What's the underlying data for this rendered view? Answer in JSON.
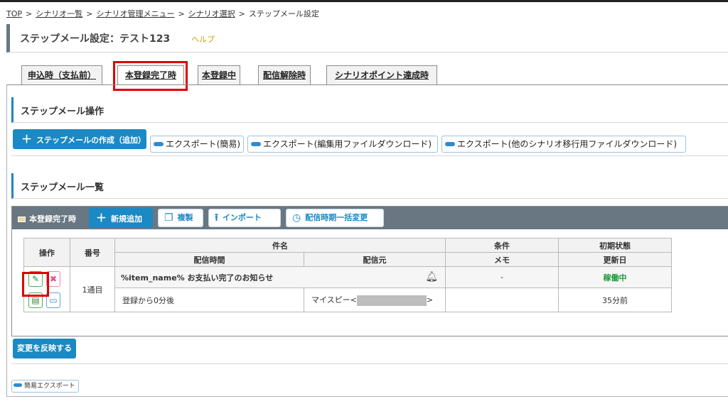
{
  "breadcrumb": {
    "items": [
      "TOP",
      "シナリオ一覧",
      "シナリオ管理メニュー",
      "シナリオ選択"
    ],
    "current": "ステップメール設定"
  },
  "page": {
    "title": "ステップメール設定：テスト123",
    "help": "ヘルプ"
  },
  "tabs": [
    "申込時（支払前）",
    "本登録完了時",
    "本登録中",
    "配信解除時",
    "シナリオポイント達成時"
  ],
  "active_tab": "本登録完了時",
  "operations": {
    "heading": "ステップメール操作",
    "create_label": "ステップメールの作成（追加）",
    "export_simple": "エクスポート(簡易)",
    "export_edit": "エクスポート(編集用ファイルダウンロード)",
    "export_migrate": "エクスポート(他のシナリオ移行用ファイルダウンロード)"
  },
  "list": {
    "heading": "ステップメール一覧",
    "bar_label": "本登録完了時",
    "add_label": "新規追加",
    "copy_label": "複製",
    "import_label": "インポート",
    "schedule_label": "配信時期一括変更",
    "columns": {
      "op": "操作",
      "num": "番号",
      "subject": "件名",
      "send_time": "配信時間",
      "sender": "配信元",
      "cond": "条件",
      "memo": "メモ",
      "init_state": "初期状態",
      "updated": "更新日"
    },
    "rows": [
      {
        "num": "1通目",
        "subject": "%item_name% お支払い完了のお知らせ",
        "send_time": "登録から0分後",
        "sender_prefix": "マイスピー<",
        "sender_suffix": ">",
        "cond": "-",
        "memo": "",
        "state": "稼働中",
        "updated": "35分前"
      }
    ]
  },
  "apply_label": "変更を反映する",
  "simple_export_label": "簡易エクスポート",
  "colors": {
    "accent": "#1a89c4",
    "bar": "#697782",
    "active": "#1a9a3a",
    "highlight": "#e00000"
  }
}
